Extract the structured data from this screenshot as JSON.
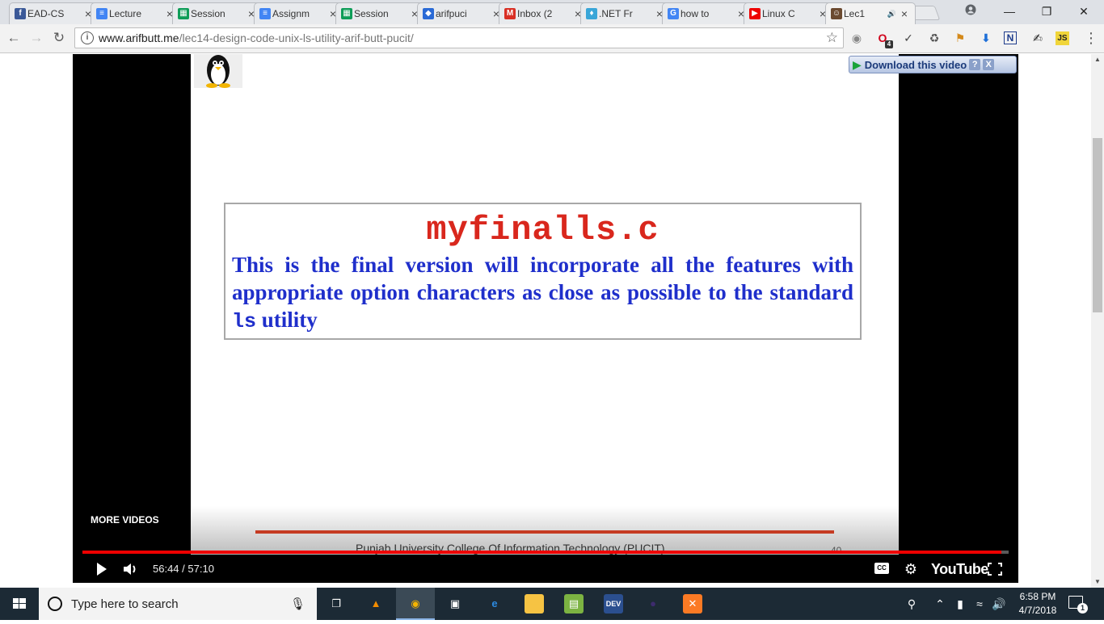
{
  "tabs": [
    {
      "title": "EAD-CS",
      "icon": "facebook-icon",
      "color": "#3b5998",
      "glyph": "f"
    },
    {
      "title": "Lecture",
      "icon": "google-docs-icon",
      "color": "#4285f4",
      "glyph": "≡"
    },
    {
      "title": "Session",
      "icon": "google-sheets-icon",
      "color": "#0f9d58",
      "glyph": "▦"
    },
    {
      "title": "Assignm",
      "icon": "google-docs-icon",
      "color": "#4285f4",
      "glyph": "≡"
    },
    {
      "title": "Session",
      "icon": "google-sheets-icon",
      "color": "#0f9d58",
      "glyph": "▦"
    },
    {
      "title": "arifpuci",
      "icon": "shield-icon",
      "color": "#2a6ad6",
      "glyph": "◆"
    },
    {
      "title": "Inbox (2",
      "icon": "gmail-icon",
      "color": "#d93025",
      "glyph": "M"
    },
    {
      "title": ".NET Fr",
      "icon": "bulb-icon",
      "color": "#39a6d8",
      "glyph": "♦"
    },
    {
      "title": "how to",
      "icon": "google-icon",
      "color": "#4285f4",
      "glyph": "G"
    },
    {
      "title": "Linux C",
      "icon": "youtube-icon",
      "color": "#e00",
      "glyph": "▶"
    },
    {
      "title": "Lec1",
      "icon": "site-avatar-icon",
      "color": "#6b4a30",
      "glyph": "☺"
    }
  ],
  "active_tab_audio_icon": "speaker-icon",
  "address": {
    "host": "www.arifbutt.me",
    "path": "/lec14-design-code-unix-ls-utility-arif-butt-pucit/"
  },
  "extensions": [
    "ext-1-icon",
    "opera-icon",
    "eyedropper-icon",
    "recycle-icon",
    "bookmark-icon",
    "download-icon",
    "n-icon",
    "puzzle-icon",
    "js-icon"
  ],
  "opera_badge": "4",
  "video": {
    "more_videos": "MORE VIDEOS",
    "download_label": "Download this video",
    "help_glyph": "?",
    "close_glyph": "X",
    "slide": {
      "title": "myfinalls.c",
      "desc_part1": "This is the final version will incorporate all the features with appropriate option characters as close as possible to the standard ",
      "desc_mono": "ls",
      "desc_part2": " utility",
      "footer": "Punjab University College Of Information Technology (PUCIT)",
      "page_number": "40"
    },
    "time_current": "56:44",
    "time_separator": " / ",
    "time_total": "57:10",
    "progress_fraction": 0.9924,
    "cc_label": "CC",
    "brand": "YouTube"
  },
  "taskbar": {
    "search_placeholder": "Type here to search",
    "apps": [
      {
        "name": "task-view-icon",
        "glyph": "❐",
        "color": "transparent"
      },
      {
        "name": "vlc-icon",
        "glyph": "▲",
        "color": "transparent",
        "fg": "#f28c00"
      },
      {
        "name": "chrome-icon",
        "glyph": "◉",
        "color": "transparent",
        "fg": "#f4b400"
      },
      {
        "name": "store-icon",
        "glyph": "▣",
        "color": "transparent",
        "fg": "#fff"
      },
      {
        "name": "edge-icon",
        "glyph": "e",
        "color": "transparent",
        "fg": "#2d8ae0"
      },
      {
        "name": "file-explorer-icon",
        "glyph": "▬",
        "color": "#f6c343",
        "fg": "#f6c343"
      },
      {
        "name": "sheet-app-icon",
        "glyph": "▤",
        "color": "#7cb342",
        "fg": "#fff"
      },
      {
        "name": "devcpp-icon",
        "glyph": "DEV",
        "color": "#2b4f8f",
        "fg": "#fff"
      },
      {
        "name": "eclipse-icon",
        "glyph": "●",
        "color": "transparent",
        "fg": "#3d2b6e"
      },
      {
        "name": "xampp-icon",
        "glyph": "✕",
        "color": "#fb7a24",
        "fg": "#fff"
      }
    ],
    "time": "6:58 PM",
    "date": "4/7/2018",
    "notification_count": "1"
  }
}
